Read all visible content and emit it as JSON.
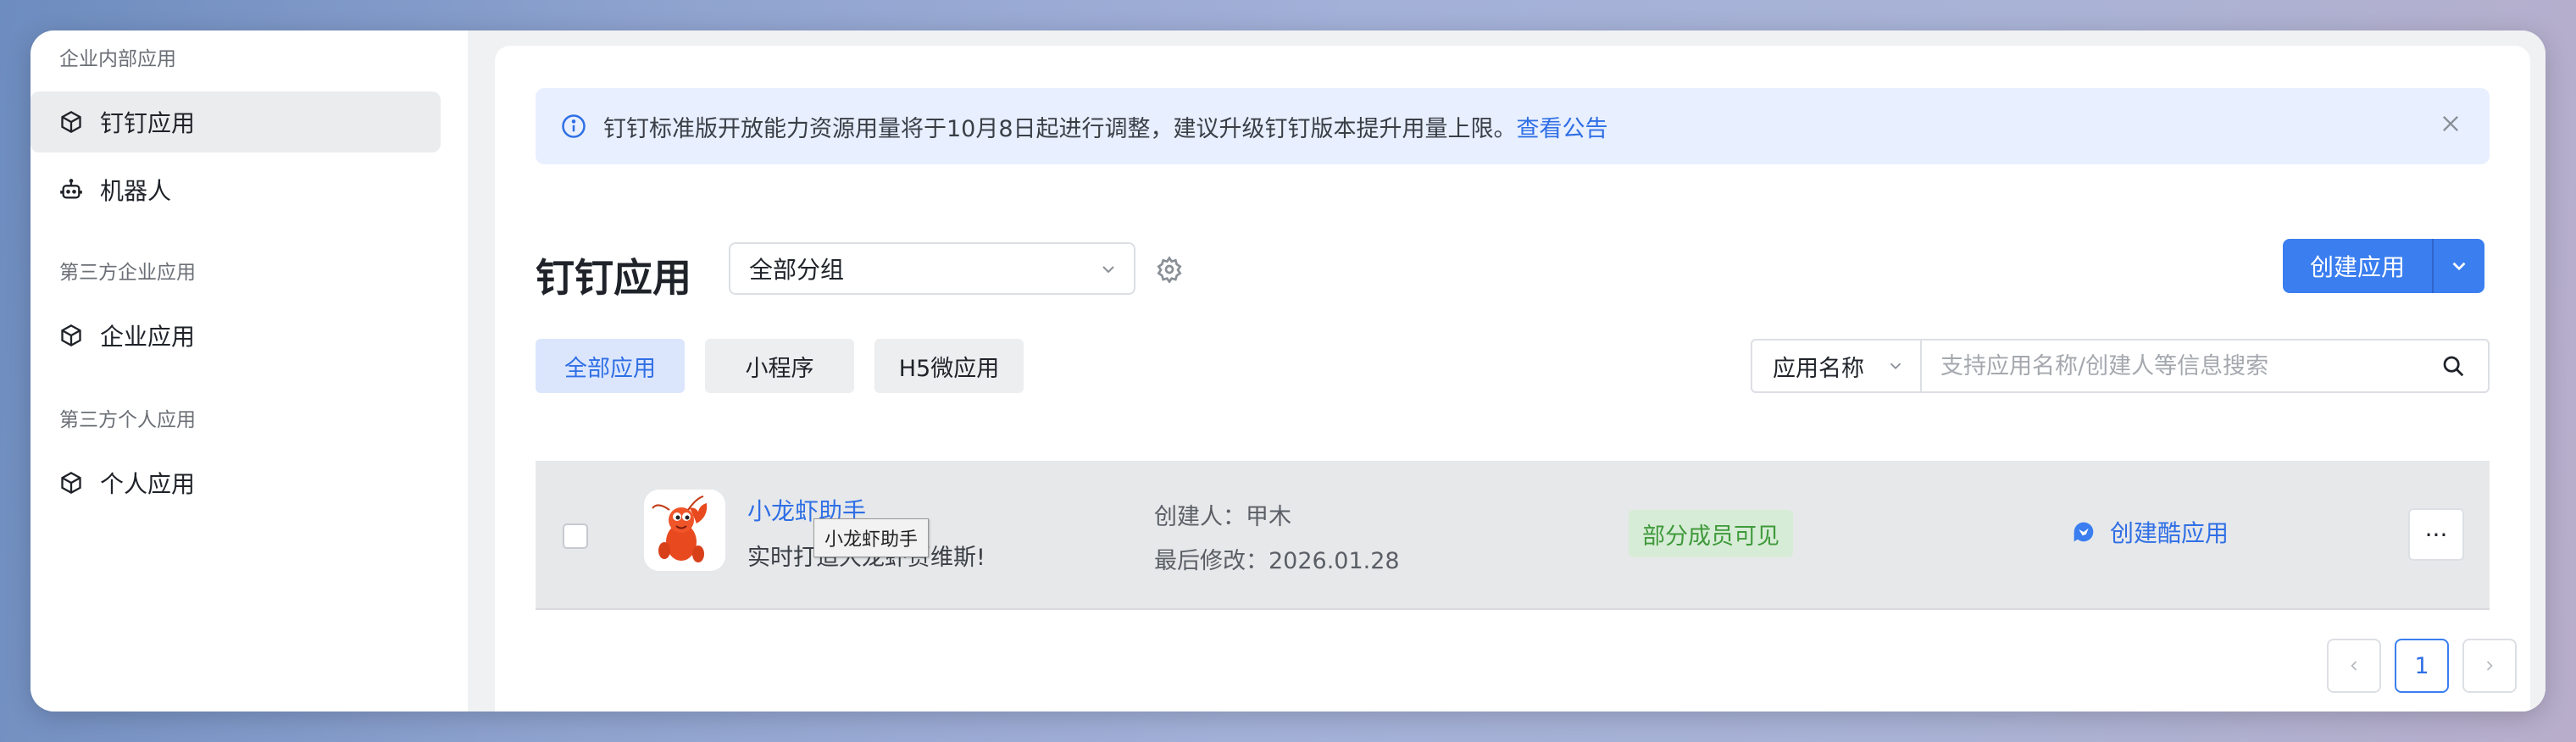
{
  "sidebar": {
    "section_internal": "企业内部应用",
    "item_dingtalk_apps": "钉钉应用",
    "item_robot": "机器人",
    "section_third_enterprise": "第三方企业应用",
    "item_enterprise_apps": "企业应用",
    "section_third_personal": "第三方个人应用",
    "item_personal_apps": "个人应用"
  },
  "notice": {
    "text": "钉钉标准版开放能力资源用量将于10月8日起进行调整，建议升级钉钉版本提升用量上限。",
    "link": "查看公告"
  },
  "header": {
    "title": "钉钉应用",
    "group_select": "全部分组",
    "create_button": "创建应用"
  },
  "tabs": [
    "全部应用",
    "小程序",
    "H5微应用"
  ],
  "search": {
    "field": "应用名称",
    "placeholder": "支持应用名称/创建人等信息搜索"
  },
  "app_row": {
    "name": "小龙虾助手",
    "description": "实时打造大龙虾贾维斯!",
    "creator": "创建人：甲木",
    "modified": "最后修改：2026.01.28",
    "visibility": "部分成员可见",
    "action": "创建酷应用",
    "more": "···"
  },
  "tooltip": "小龙虾助手",
  "pagination": {
    "current_page": "1"
  },
  "colors": {
    "primary": "#3a7ef0",
    "link": "#2f6fe5",
    "success_bg": "#d7ecd6",
    "success_text": "#3f9a3b"
  }
}
